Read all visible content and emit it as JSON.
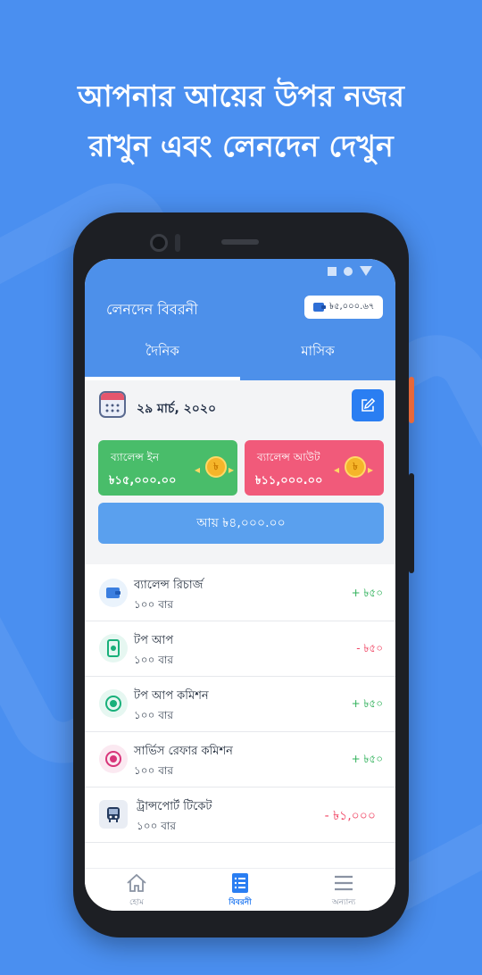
{
  "headline": {
    "line1": "আপনার আয়ের উপর নজর",
    "line2": "রাখুন এবং লেনদেন দেখুন"
  },
  "appbar": {
    "title": "লেনদেন বিবরনী",
    "wallet_balance": "৳৫,০০০.৬৭",
    "tabs": [
      {
        "label": "দৈনিক",
        "active": true
      },
      {
        "label": "মাসিক",
        "active": false
      }
    ]
  },
  "date_row": {
    "date": "২৯ মার্চ, ২০২০"
  },
  "cards": {
    "balance_in": {
      "label": "ব্যালেন্স ইন",
      "amount": "৳১৫,০০০.০০"
    },
    "balance_out": {
      "label": "ব্যালেন্স আউট",
      "amount": "৳১১,০০০.০০"
    }
  },
  "income": {
    "label": "আয়  ৳৪,০০০.০০"
  },
  "transactions": [
    {
      "name": "ব্যালেন্স রিচার্জ",
      "count": "১০০ বার",
      "amount": "+ ৳৫০",
      "type": "credit",
      "icon": "wallet-icon"
    },
    {
      "name": "টপ আপ",
      "count": "১০০ বার",
      "amount": "- ৳৫০",
      "type": "debit",
      "icon": "mobile-topup-icon"
    },
    {
      "name": "টপ আপ কমিশন",
      "count": "১০০ বার",
      "amount": "+ ৳৫০",
      "type": "credit",
      "icon": "commission-icon"
    },
    {
      "name": "সার্ভিস রেফার কমিশন",
      "count": "১০০ বার",
      "amount": "+ ৳৫০",
      "type": "credit",
      "icon": "refer-commission-icon"
    },
    {
      "name": "ট্রান্সপোর্ট টিকেট",
      "count": "১০০ বার",
      "amount": "-  ৳১,০০০",
      "type": "debit",
      "icon": "bus-icon"
    }
  ],
  "bottom_nav": [
    {
      "label": "হোম",
      "icon": "home-icon",
      "active": false
    },
    {
      "label": "বিবরনী",
      "icon": "statement-icon",
      "active": true
    },
    {
      "label": "অন্যান্য",
      "icon": "menu-icon",
      "active": false
    }
  ],
  "colors": {
    "background": "#4a8ff0",
    "appbar": "#4d90ea",
    "balance_in": "#49bd6a",
    "balance_out": "#f15a7a",
    "credit": "#2fb15a",
    "debit": "#f04866",
    "accent": "#2a7ef2"
  }
}
